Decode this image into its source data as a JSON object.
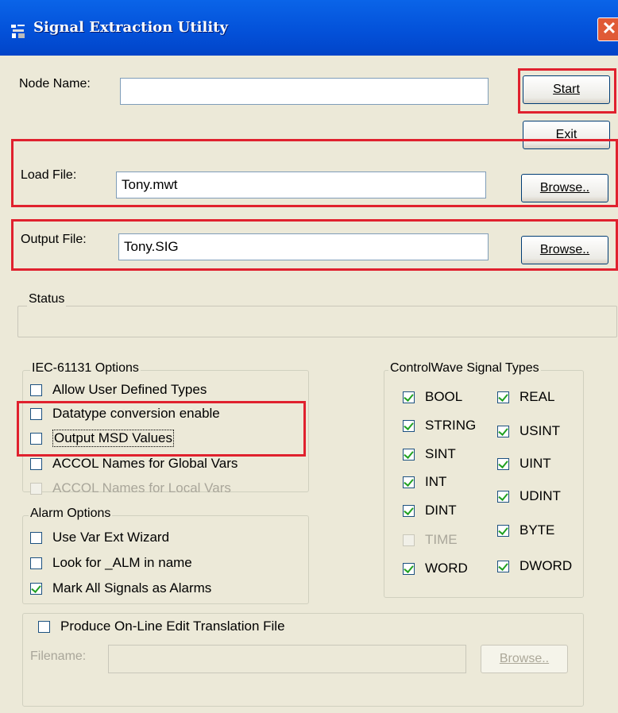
{
  "window": {
    "title": "Signal Extraction Utility",
    "close_glyph": "✕",
    "icon": "app-icon"
  },
  "node": {
    "label": "Node Name:",
    "value": ""
  },
  "buttons": {
    "start": "Start",
    "exit": "Exit",
    "browse_load": "Browse..",
    "browse_output": "Browse..",
    "browse_online": "Browse.."
  },
  "load_file": {
    "label": "Load File:",
    "value": "Tony.mwt"
  },
  "output_file": {
    "label": "Output File:",
    "value": "Tony.SIG"
  },
  "status": {
    "label": "Status",
    "text": ""
  },
  "iec": {
    "title": "IEC-61131 Options",
    "options": [
      {
        "label": "Allow User Defined Types",
        "checked": false,
        "enabled": true
      },
      {
        "label": "Datatype conversion enable",
        "checked": false,
        "enabled": true
      },
      {
        "label": "Output MSD Values",
        "checked": false,
        "enabled": true
      },
      {
        "label": "ACCOL Names for Global Vars",
        "checked": false,
        "enabled": true
      },
      {
        "label": "ACCOL Names for Local Vars",
        "checked": false,
        "enabled": false
      }
    ]
  },
  "alarm": {
    "title": "Alarm Options",
    "options": [
      {
        "label": "Use Var Ext Wizard",
        "checked": false
      },
      {
        "label": "Look for _ALM in name",
        "checked": false
      },
      {
        "label": "Mark All Signals as Alarms",
        "checked": true
      }
    ]
  },
  "cw": {
    "title": "ControlWave Signal Types",
    "left": [
      {
        "label": "BOOL",
        "checked": true,
        "enabled": true
      },
      {
        "label": "STRING",
        "checked": true,
        "enabled": true
      },
      {
        "label": "SINT",
        "checked": true,
        "enabled": true
      },
      {
        "label": "INT",
        "checked": true,
        "enabled": true
      },
      {
        "label": "DINT",
        "checked": true,
        "enabled": true
      },
      {
        "label": "TIME",
        "checked": false,
        "enabled": false
      },
      {
        "label": "WORD",
        "checked": true,
        "enabled": true
      }
    ],
    "right": [
      {
        "label": "REAL",
        "checked": true
      },
      {
        "label": "USINT",
        "checked": true
      },
      {
        "label": "UINT",
        "checked": true
      },
      {
        "label": "UDINT",
        "checked": true
      },
      {
        "label": "BYTE",
        "checked": true
      },
      {
        "label": "DWORD",
        "checked": true
      }
    ]
  },
  "online": {
    "checkbox_label": "Produce On-Line Edit Translation File",
    "checked": false,
    "filename_label": "Filename:",
    "filename_value": ""
  },
  "colors": {
    "highlight": "#e0212e",
    "titlebar": "#0350d8",
    "face": "#ece9d8"
  }
}
